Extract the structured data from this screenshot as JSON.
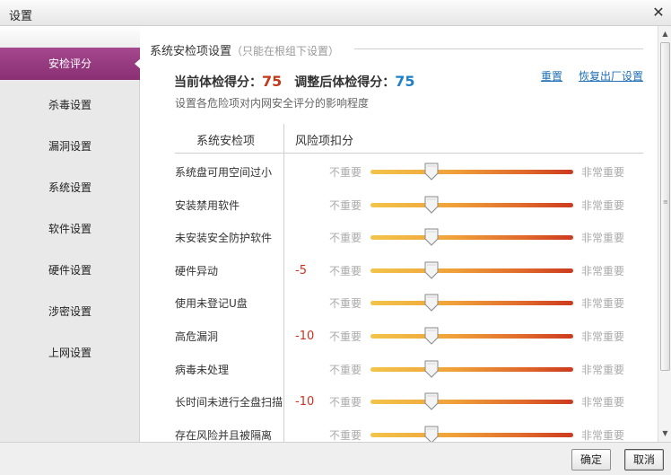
{
  "window": {
    "title": "设置",
    "close_glyph": "✕"
  },
  "sidebar": {
    "items": [
      {
        "label": "安检评分",
        "active": true
      },
      {
        "label": "杀毒设置",
        "active": false
      },
      {
        "label": "漏洞设置",
        "active": false
      },
      {
        "label": "系统设置",
        "active": false
      },
      {
        "label": "软件设置",
        "active": false
      },
      {
        "label": "硬件设置",
        "active": false
      },
      {
        "label": "涉密设置",
        "active": false
      },
      {
        "label": "上网设置",
        "active": false
      }
    ]
  },
  "section": {
    "title": "系统安检项设置",
    "hint": "（只能在根组下设置）"
  },
  "score": {
    "current_label": "当前体检得分：",
    "current_value": "75",
    "adjusted_label": "调整后体检得分：",
    "adjusted_value": "75"
  },
  "links": {
    "reset": "重置",
    "restore": "恢复出厂设置"
  },
  "description": "设置各危险项对内网安全评分的影响程度",
  "table": {
    "col_item": "系统安检项",
    "col_penalty": "风险项扣分",
    "low_label": "不重要",
    "high_label": "非常重要",
    "rows": [
      {
        "name": "系统盘可用空间过小",
        "penalty": "",
        "level": 0.3
      },
      {
        "name": "安装禁用软件",
        "penalty": "",
        "level": 0.3
      },
      {
        "name": "未安装安全防护软件",
        "penalty": "",
        "level": 0.3
      },
      {
        "name": "硬件异动",
        "penalty": "-5",
        "level": 0.3
      },
      {
        "name": "使用未登记U盘",
        "penalty": "",
        "level": 0.3
      },
      {
        "name": "高危漏洞",
        "penalty": "-10",
        "level": 0.3
      },
      {
        "name": "病毒未处理",
        "penalty": "",
        "level": 0.3
      },
      {
        "name": "长时间未进行全盘扫描",
        "penalty": "-10",
        "level": 0.3
      },
      {
        "name": "存在风险并且被隔离",
        "penalty": "",
        "level": 0.3
      }
    ]
  },
  "buttons": {
    "ok": "确定",
    "cancel": "取消"
  },
  "colors": {
    "accent": "#9a3b80",
    "score_current": "#c0391b",
    "score_adjusted": "#1f7fc7",
    "penalty": "#d0301e",
    "link": "#1f6fb5"
  }
}
